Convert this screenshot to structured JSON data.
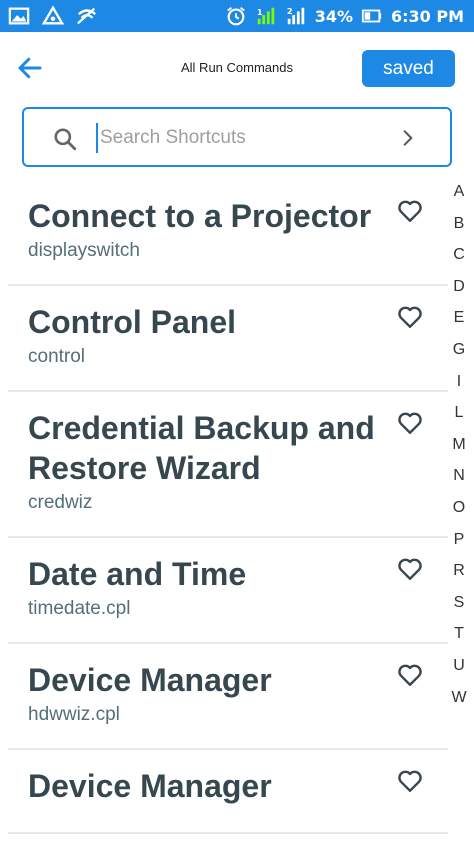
{
  "status_bar": {
    "battery": "34%",
    "time": "6:30 PM"
  },
  "header": {
    "title": "All Run Commands",
    "saved_label": "saved"
  },
  "search": {
    "placeholder": "Search Shortcuts",
    "value": ""
  },
  "items": [
    {
      "title": "Connect to a Projector",
      "command": "displayswitch"
    },
    {
      "title": "Control Panel",
      "command": "control"
    },
    {
      "title": "Credential Backup and Restore Wizard",
      "command": "credwiz"
    },
    {
      "title": "Date and Time",
      "command": "timedate.cpl"
    },
    {
      "title": "Device Manager",
      "command": "hdwwiz.cpl"
    },
    {
      "title": "Device Manager",
      "command": ""
    }
  ],
  "alphabet": [
    "A",
    "B",
    "C",
    "D",
    "E",
    "G",
    "I",
    "L",
    "M",
    "N",
    "O",
    "P",
    "R",
    "S",
    "T",
    "U",
    "W"
  ],
  "colors": {
    "accent": "#1e88e5",
    "title_text": "#37474f"
  },
  "icons": {
    "back": "arrow-left-icon",
    "search": "magnifier-icon",
    "go": "chevron-right-icon",
    "favorite": "heart-outline-icon"
  }
}
